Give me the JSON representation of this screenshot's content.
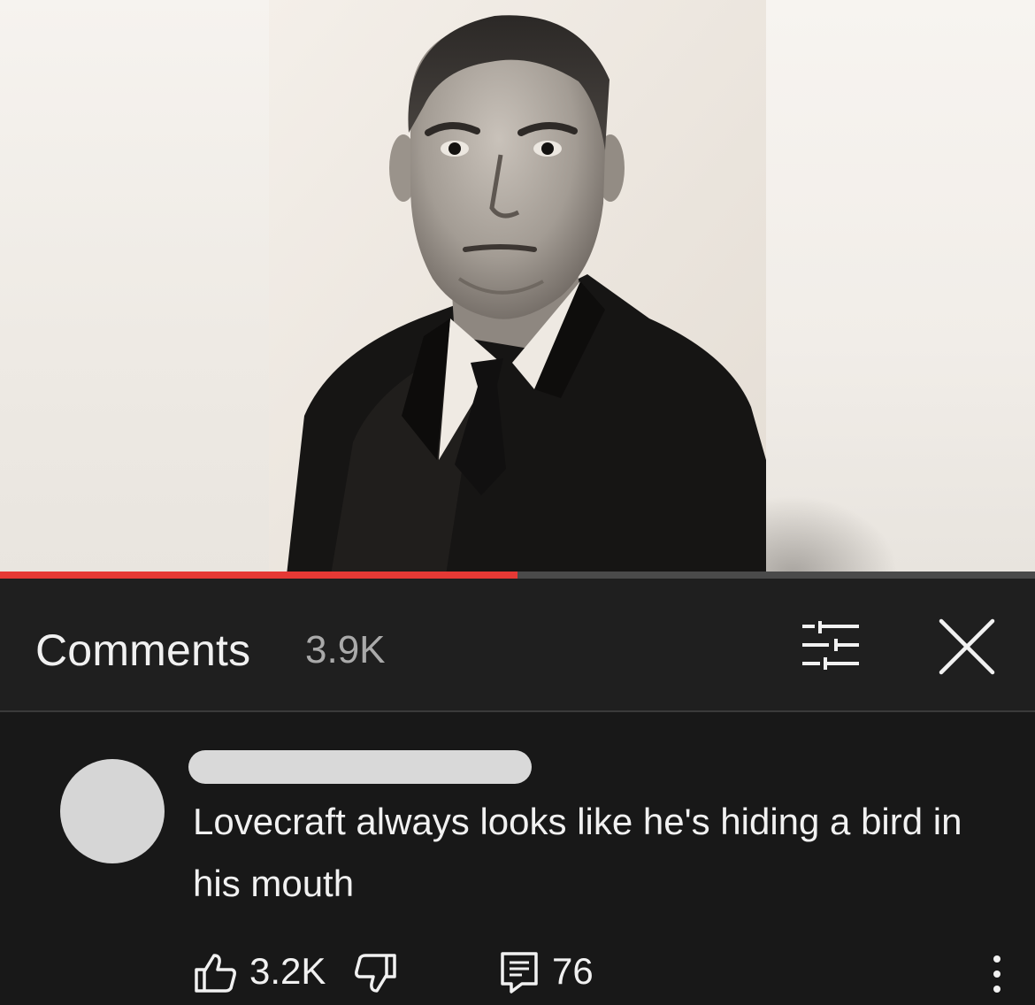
{
  "video": {
    "progress_fraction": 0.5,
    "progress_color": "#e53935"
  },
  "comments_panel": {
    "title": "Comments",
    "count": "3.9K",
    "filter_icon": "sort-filter-icon",
    "close_icon": "close-icon"
  },
  "comment": {
    "avatar_color": "#d6d6d6",
    "text": "Lovecraft always looks like he's hiding a bird in his mouth",
    "likes": "3.2K",
    "replies": "76",
    "icons": {
      "like": "thumbs-up-icon",
      "dislike": "thumbs-down-icon",
      "reply": "reply-icon",
      "more": "more-vertical-icon"
    }
  }
}
